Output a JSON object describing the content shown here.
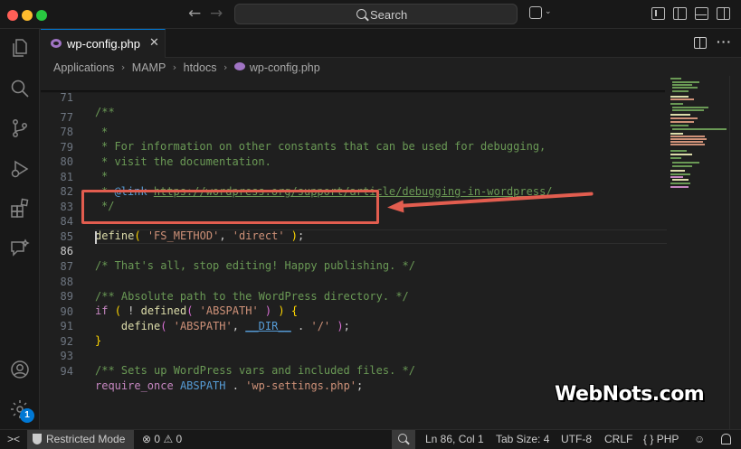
{
  "titlebar": {
    "search_placeholder": "Search",
    "icons": [
      "back-arrow-icon",
      "forward-arrow-icon",
      "search-icon",
      "copilot-icon",
      "toggle-primary-sidebar-icon",
      "toggle-panel-icon",
      "toggle-secondary-sidebar-icon",
      "customize-layout-icon"
    ]
  },
  "activity_bar": {
    "items": [
      "explorer-icon",
      "search-icon",
      "source-control-icon",
      "run-debug-icon",
      "extensions-icon",
      "chat-icon",
      "accounts-icon",
      "manage-gear-icon"
    ],
    "badge": "1"
  },
  "tab": {
    "label": "wp-config.php",
    "close": "✕"
  },
  "breadcrumb": {
    "items": [
      "Applications",
      "MAMP",
      "htdocs",
      "wp-config.php"
    ],
    "separator": "›"
  },
  "editor": {
    "sticky_line": {
      "num": "71",
      "text": "/**"
    },
    "lines": [
      {
        "num": "77",
        "text": "*"
      },
      {
        "num": "78",
        "text": "* For information on other constants that can be used for debugging,"
      },
      {
        "num": "79",
        "text": "* visit the documentation."
      },
      {
        "num": "80",
        "text": "*"
      },
      {
        "num": "81",
        "tag": "* @link ",
        "link": "https://wordpress.org/support/article/debugging-in-wordpress/"
      },
      {
        "num": "82",
        "text": "*/"
      },
      {
        "num": "83",
        "text": ""
      },
      {
        "num": "84",
        "fn": "define",
        "args": [
          "'FS_METHOD'",
          "'direct'"
        ]
      },
      {
        "num": "85",
        "text": ""
      },
      {
        "num": "86",
        "text": "/* That's all, stop editing! Happy publishing. */"
      },
      {
        "num": "87",
        "text": ""
      },
      {
        "num": "88",
        "text": "/** Absolute path to the WordPress directory. */"
      },
      {
        "num": "89",
        "kw": "if",
        "fn": "defined",
        "arg": "'ABSPATH'"
      },
      {
        "num": "90",
        "fn": "define",
        "arg1": "'ABSPATH'",
        "const": "__DIR__",
        "arg2": "'/'"
      },
      {
        "num": "91",
        "text": "}"
      },
      {
        "num": "92",
        "text": ""
      },
      {
        "num": "93",
        "text": "/** Sets up WordPress vars and included files. */"
      },
      {
        "num": "94",
        "kw": "require_once",
        "const": "ABSPATH",
        "arg": "'wp-settings.php'"
      }
    ],
    "active_line": "86"
  },
  "watermark": "WebNots.com",
  "statusbar": {
    "restricted_mode": "Restricted Mode",
    "errors": "0",
    "warnings": "0",
    "cursor": "Ln 86, Col 1",
    "tab_size": "Tab Size: 4",
    "encoding": "UTF-8",
    "eol": "CRLF",
    "language": "PHP",
    "language_braces": "{ }"
  },
  "colors": {
    "background": "#1f1f1f",
    "accent": "#0078d4",
    "annotation": "#e25d4f",
    "comment": "#6a9955",
    "string": "#ce9178",
    "function": "#dcdcaa"
  }
}
